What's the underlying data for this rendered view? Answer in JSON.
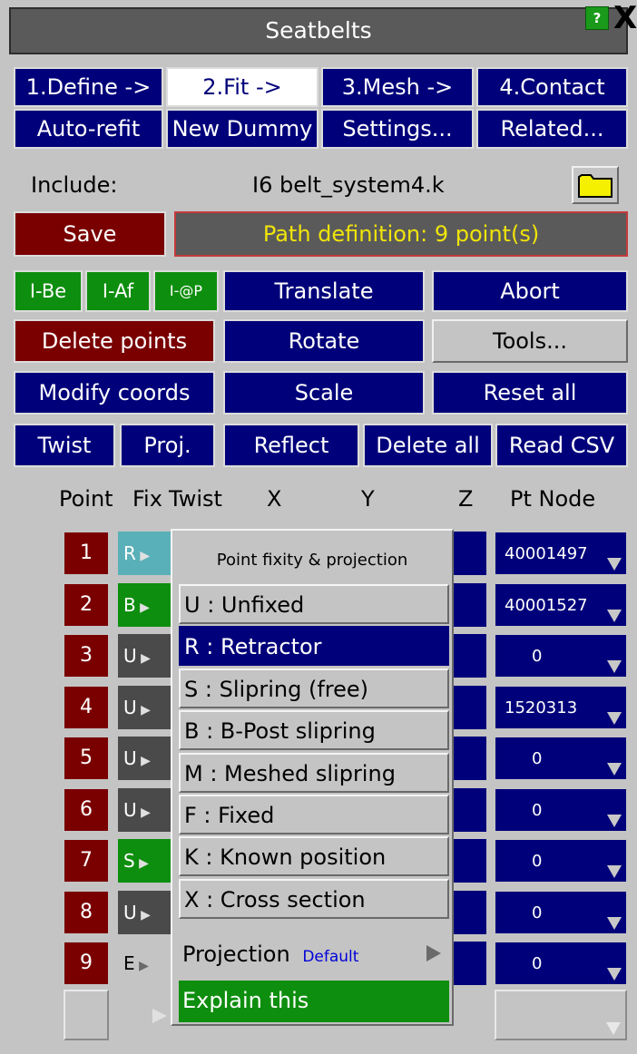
{
  "window": {
    "title": "Seatbelts",
    "help_label": "?",
    "close_label": "X"
  },
  "steps": [
    "1.Define ->",
    "2.Fit ->",
    "3.Mesh ->",
    "4.Contact"
  ],
  "actions_row": [
    "Auto-refit",
    "New Dummy",
    "Settings...",
    "Related..."
  ],
  "include": {
    "label": "Include:",
    "value": "I6  belt_system4.k"
  },
  "save_label": "Save",
  "status_text": "Path definition: 9 point(s)",
  "tools": {
    "i_be": "I-Be",
    "i_af": "I-Af",
    "i_at": "I-@P",
    "translate": "Translate",
    "abort": "Abort",
    "delete_points": "Delete points",
    "rotate": "Rotate",
    "tools": "Tools...",
    "modify_coords": "Modify coords",
    "scale": "Scale",
    "reset_all": "Reset all",
    "twist": "Twist",
    "proj": "Proj.",
    "reflect": "Reflect",
    "delete_all": "Delete all",
    "read_csv": "Read CSV"
  },
  "table_headers": {
    "point": "Point",
    "fix": "Fix",
    "twist": "Twist",
    "x": "X",
    "y": "Y",
    "z": "Z",
    "pt_node": "Pt Node"
  },
  "rows": [
    {
      "point": "1",
      "fix": "R",
      "node": "40001497"
    },
    {
      "point": "2",
      "fix": "B",
      "node": "40001527"
    },
    {
      "point": "3",
      "fix": "U",
      "node": "0"
    },
    {
      "point": "4",
      "fix": "U",
      "node": "1520313"
    },
    {
      "point": "5",
      "fix": "U",
      "node": "0"
    },
    {
      "point": "6",
      "fix": "U",
      "node": "0"
    },
    {
      "point": "7",
      "fix": "S",
      "node": "0"
    },
    {
      "point": "8",
      "fix": "U",
      "node": "0"
    },
    {
      "point": "9",
      "fix": "E",
      "node": "0"
    }
  ],
  "popup": {
    "title": "Point fixity & projection",
    "options": [
      "U : Unfixed",
      "R : Retractor",
      "S : Slipring (free)",
      "B : B-Post slipring",
      "M : Meshed slipring",
      "F : Fixed",
      "K : Known position",
      "X : Cross section"
    ],
    "selected": "R : Retractor",
    "projection_label": "Projection",
    "projection_value": "Default",
    "explain_label": "Explain this"
  },
  "colors": {
    "panel": "#c4c4c4",
    "button_blue": "#00007a",
    "button_red": "#7a0000",
    "button_green": "#0e8e0e",
    "status_text": "#f0e40a"
  }
}
